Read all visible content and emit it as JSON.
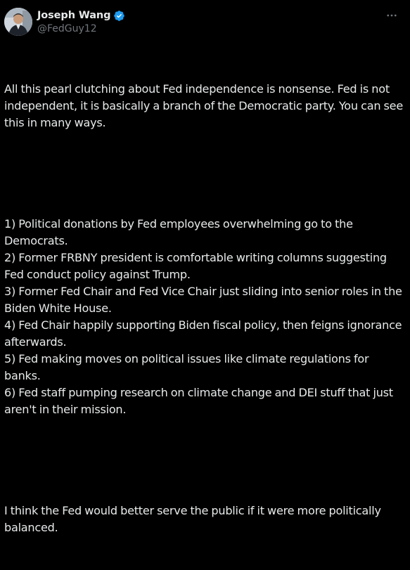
{
  "author": {
    "name": "Joseph Wang",
    "handle": "@FedGuy12",
    "verified": true,
    "verified_color": "#1d9bf0"
  },
  "icons": {
    "verified": "verified-badge-icon",
    "more": "more-options-icon"
  },
  "tweet": {
    "paragraphs": [
      "All this pearl clutching about Fed independence is nonsense. Fed is not independent, it is basically a branch of the Democratic party. You can see this in many ways.",
      "",
      "1) Political donations by Fed employees overwhelming go to the Democrats.\n2) Former FRBNY president is comfortable writing columns suggesting Fed conduct policy against Trump.\n3) Former Fed Chair and Fed Vice Chair just sliding into senior roles in the Biden White House.\n4) Fed Chair happily supporting Biden fiscal policy, then feigns ignorance afterwards.\n5) Fed making moves on political issues like climate regulations for banks.\n6) Fed staff pumping research on climate change and DEI stuff that just aren't in their mission.",
      "",
      "I think the Fed would better serve the public if it were more politically balanced."
    ]
  },
  "colors": {
    "background": "#000000",
    "text": "#e7e9ea",
    "secondary": "#71767b"
  }
}
